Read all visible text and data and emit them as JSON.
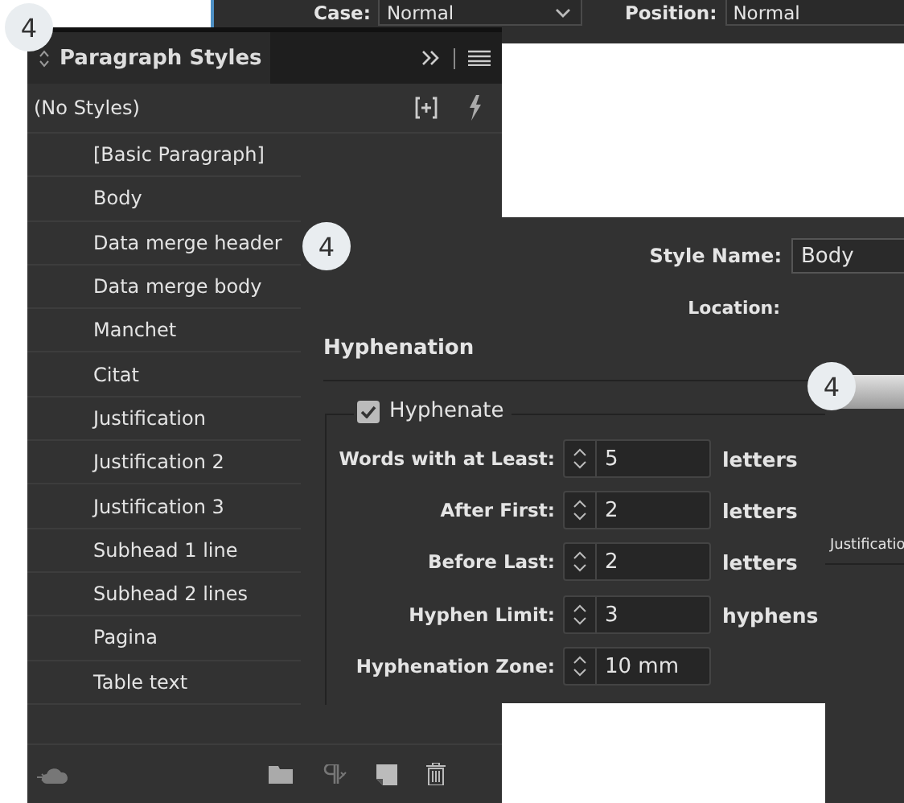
{
  "top_bar": {
    "fields": [
      {
        "label": "Case:",
        "value": "Normal",
        "kind": "dropdown"
      },
      {
        "label": "Position:",
        "value": "Normal",
        "kind": "text"
      }
    ]
  },
  "badges": [
    "4",
    "4",
    "4"
  ],
  "paragraph_styles": {
    "title": "Paragraph Styles",
    "default_style": "(No Styles)",
    "styles": [
      {
        "name": "[Basic Paragraph]",
        "selected": false
      },
      {
        "name": "Body",
        "selected": false
      },
      {
        "name": "Data merge header",
        "selected": false
      },
      {
        "name": "Data merge body",
        "selected": false
      },
      {
        "name": "Manchet",
        "selected": false
      },
      {
        "name": "Citat",
        "selected": false
      },
      {
        "name": "Justification",
        "selected": false
      },
      {
        "name": "Justification 2",
        "selected": false
      },
      {
        "name": "Justification 3",
        "selected": false
      },
      {
        "name": "Subhead 1 line",
        "selected": false
      },
      {
        "name": "Subhead 2 lines",
        "selected": false
      },
      {
        "name": "Pagina",
        "selected": false
      },
      {
        "name": "Table text",
        "selected": false
      }
    ]
  },
  "dialog": {
    "style_name_label": "Style Name:",
    "style_name": "Body",
    "location_label": "Location:",
    "section": "Hyphenation",
    "hyphenate": {
      "label": "Hyphenate",
      "checked": true
    },
    "fields": [
      {
        "label": "Words with at Least:",
        "value": "5",
        "unit": "letters"
      },
      {
        "label": "After First:",
        "value": "2",
        "unit": "letters"
      },
      {
        "label": "Before Last:",
        "value": "2",
        "unit": "letters"
      },
      {
        "label": "Hyphen Limit:",
        "value": "3",
        "unit": "hyphens"
      },
      {
        "label": "Hyphenation Zone:",
        "value": "10 mm"
      }
    ]
  },
  "side_panel": {
    "item": "Justificatio"
  }
}
